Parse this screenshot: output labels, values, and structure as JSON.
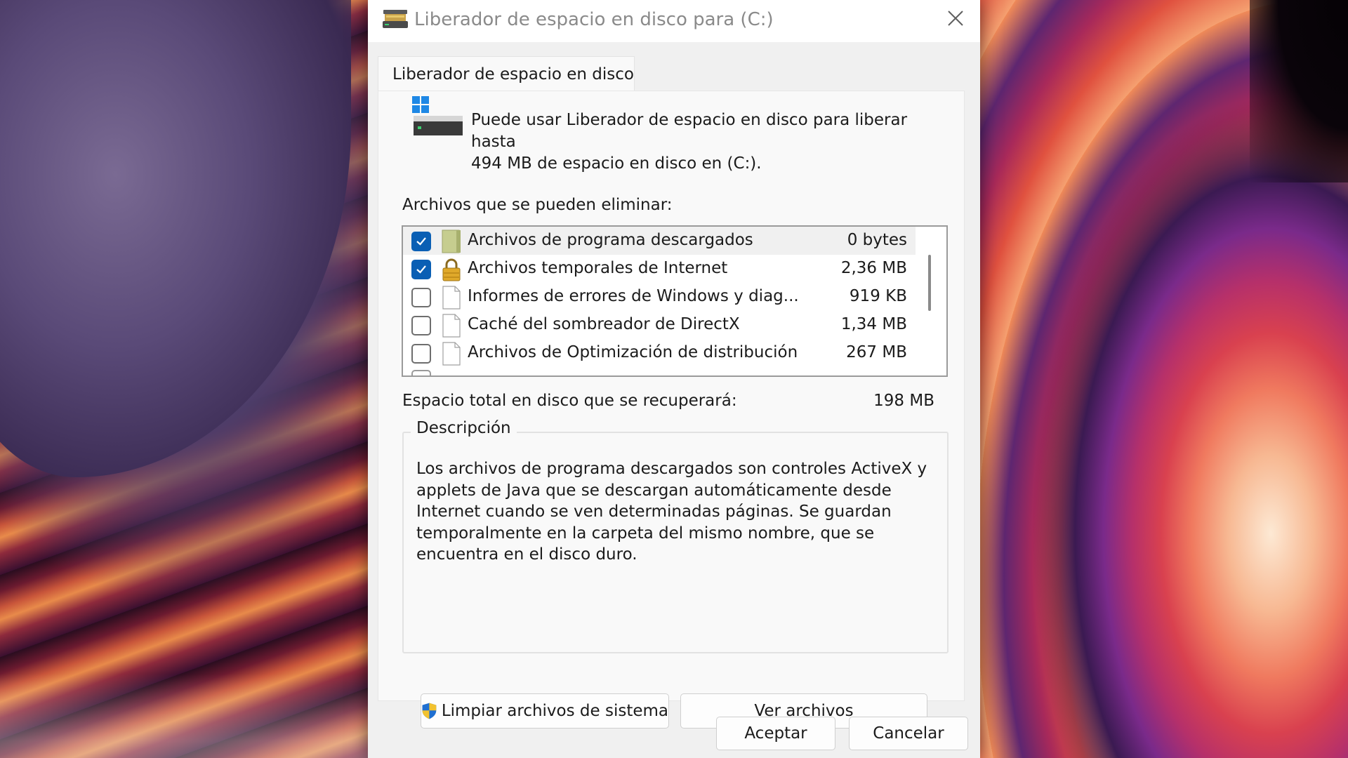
{
  "window": {
    "title": "Liberador de espacio en disco para  (C:)",
    "icon": "disk-cleanup-icon"
  },
  "tab": {
    "label": "Liberador de espacio en disco"
  },
  "intro": {
    "line1": "Puede usar Liberador de espacio en disco para liberar hasta",
    "line2": "494 MB de espacio en disco en  (C:)."
  },
  "files": {
    "label": "Archivos que se pueden eliminar:",
    "items": [
      {
        "name": "Archivos de programa descargados",
        "size": "0 bytes",
        "checked": true,
        "icon": "folder-icon",
        "selected": true
      },
      {
        "name": "Archivos temporales de Internet",
        "size": "2,36 MB",
        "checked": true,
        "icon": "lock-icon",
        "selected": false
      },
      {
        "name": "Informes de errores de Windows y diag...",
        "size": "919 KB",
        "checked": false,
        "icon": "document-icon",
        "selected": false
      },
      {
        "name": "Caché del sombreador de DirectX",
        "size": "1,34 MB",
        "checked": false,
        "icon": "document-icon",
        "selected": false
      },
      {
        "name": "Archivos de Optimización de distribución",
        "size": "267 MB",
        "checked": false,
        "icon": "document-icon",
        "selected": false
      }
    ]
  },
  "total": {
    "label": "Espacio total en disco que se recuperará:",
    "value": "198 MB"
  },
  "description": {
    "legend": "Descripción",
    "text": "Los archivos de programa descargados son controles ActiveX y applets de Java que se descargan automáticamente desde Internet cuando se ven determinadas páginas. Se guardan temporalmente en la carpeta del mismo nombre, que se encuentra en el disco duro."
  },
  "buttons": {
    "clean_system": "Limpiar archivos de sistema",
    "view_files": "Ver archivos",
    "ok": "Aceptar",
    "cancel": "Cancelar"
  },
  "colors": {
    "checkbox_accent": "#0a5fb4",
    "dialog_bg": "#f0f0f0"
  }
}
